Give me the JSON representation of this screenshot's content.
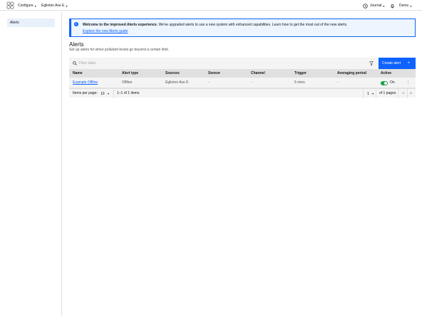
{
  "header": {
    "configure_label": "Configure",
    "location_label": "Eglinton Ave E",
    "journal_label": "Journal",
    "user_label": "Demo"
  },
  "sidebar": {
    "items": [
      {
        "label": "Alerts",
        "active": true
      }
    ]
  },
  "banner": {
    "title": "Welcome to the improved Alerts experience.",
    "message": "We've upgraded alerts to use a new system with enhanced capabilities. Learn how to get the most out of the new alerts.",
    "link": "Explore the new Alerts guide"
  },
  "page": {
    "title": "Alerts",
    "subtitle": "Set up alerts for when pollutant levels go beyond a certain limit."
  },
  "toolbar": {
    "filter_placeholder": "Filter table",
    "create_label": "Create alert"
  },
  "table": {
    "columns": [
      "Name",
      "Alert type",
      "Sources",
      "Sensor",
      "Channel",
      "Trigger",
      "Averaging period",
      "Active"
    ],
    "rows": [
      {
        "name": "Example Offline",
        "alert_type": "Offline",
        "sources": "Eglinton Ave E",
        "sensor": "-",
        "channel": "-",
        "trigger": "5 mins",
        "averaging_period": "-",
        "active": "On",
        "active_state": true
      }
    ]
  },
  "pagination": {
    "items_per_page_label": "Items per page:",
    "items_per_page_value": "10",
    "range_label": "1–1 of 1 items",
    "page_value": "1",
    "pages_label": "of 1 pages"
  },
  "colors": {
    "accent": "#0f62fe",
    "toggle_on": "#24a148",
    "banner_bg": "#edf5ff"
  }
}
